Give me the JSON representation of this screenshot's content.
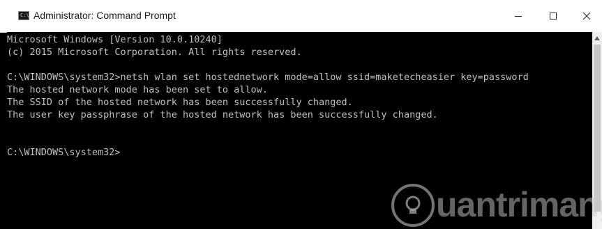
{
  "window": {
    "title": "Administrator: Command Prompt",
    "app_icon_text": "C:\\"
  },
  "console": {
    "lines": [
      "Microsoft Windows [Version 10.0.10240]",
      "(c) 2015 Microsoft Corporation. All rights reserved.",
      "",
      "C:\\WINDOWS\\system32>netsh wlan set hostednetwork mode=allow ssid=maketecheasier key=password",
      "The hosted network mode has been set to allow.",
      "The SSID of the hosted network has been successfully changed.",
      "The user key passphrase of the hosted network has been successfully changed.",
      "",
      "",
      "C:\\WINDOWS\\system32>"
    ]
  },
  "watermark": {
    "text": "uantrimang"
  },
  "colors": {
    "console_background": "#000000",
    "console_text": "#c0c0c0",
    "titlebar_background": "#ffffff"
  }
}
